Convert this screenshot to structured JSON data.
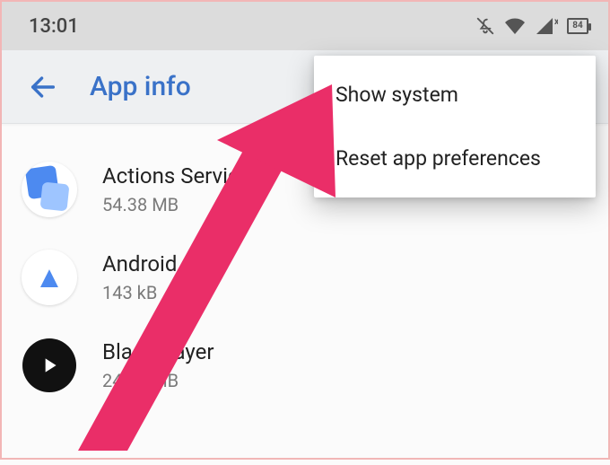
{
  "status": {
    "time": "13:01",
    "battery": "84"
  },
  "appbar": {
    "title": "App info"
  },
  "menu": {
    "items": [
      "Show system",
      "Reset app preferences"
    ]
  },
  "apps": [
    {
      "name": "Actions Services",
      "size": "54.38 MB"
    },
    {
      "name": "Android Auto",
      "size": "143 kB"
    },
    {
      "name": "BlackPlayer",
      "size": "24.93 MB"
    }
  ],
  "annotation": {
    "color": "#ea2e68"
  }
}
